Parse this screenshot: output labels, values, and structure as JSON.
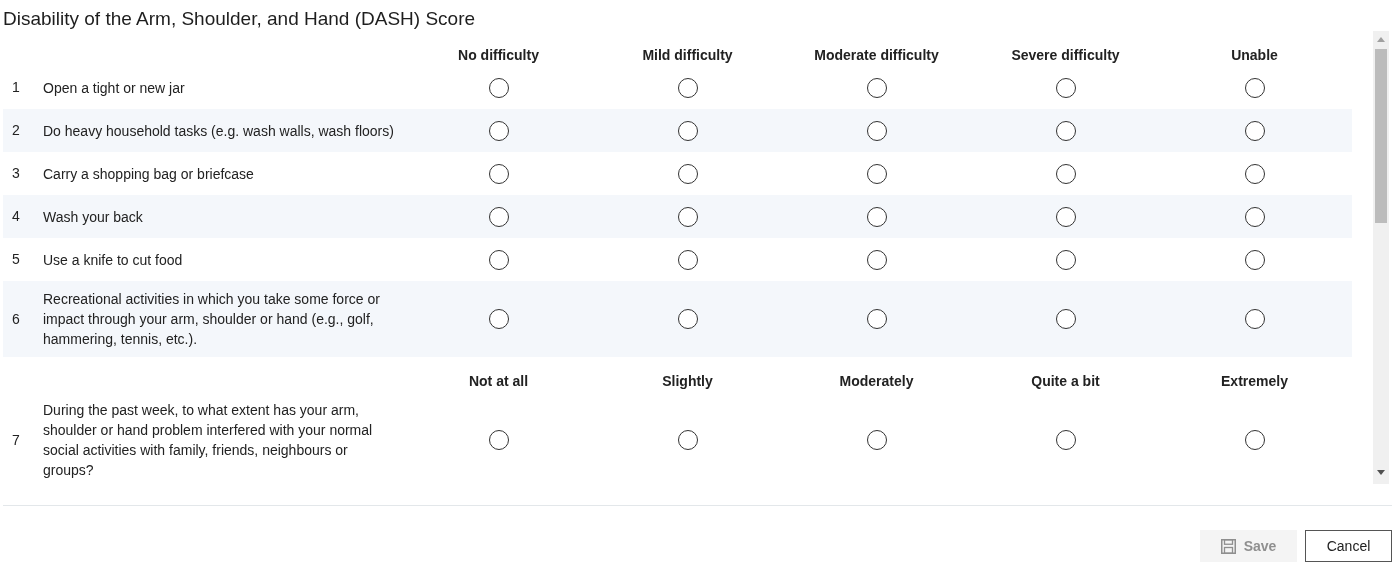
{
  "title": "Disability of the Arm, Shoulder, and Hand (DASH) Score",
  "sections": [
    {
      "options": [
        "No difficulty",
        "Mild difficulty",
        "Moderate difficulty",
        "Severe difficulty",
        "Unable"
      ],
      "questions": [
        {
          "number": "1",
          "text": "Open a tight or new jar",
          "answers": [
            {
              "selected": false
            },
            {
              "selected": false
            },
            {
              "selected": false
            },
            {
              "selected": false
            },
            {
              "selected": false
            }
          ]
        },
        {
          "number": "2",
          "text": "Do heavy household tasks (e.g. wash walls, wash floors)",
          "answers": [
            {
              "selected": false
            },
            {
              "selected": false
            },
            {
              "selected": false
            },
            {
              "selected": false
            },
            {
              "selected": false
            }
          ]
        },
        {
          "number": "3",
          "text": "Carry a shopping bag or briefcase",
          "answers": [
            {
              "selected": false
            },
            {
              "selected": false
            },
            {
              "selected": false
            },
            {
              "selected": false
            },
            {
              "selected": false
            }
          ]
        },
        {
          "number": "4",
          "text": "Wash your back",
          "answers": [
            {
              "selected": false
            },
            {
              "selected": false
            },
            {
              "selected": false
            },
            {
              "selected": false
            },
            {
              "selected": false
            }
          ]
        },
        {
          "number": "5",
          "text": "Use a knife to cut food",
          "answers": [
            {
              "selected": false
            },
            {
              "selected": false
            },
            {
              "selected": false
            },
            {
              "selected": false
            },
            {
              "selected": false
            }
          ]
        },
        {
          "number": "6",
          "text": "Recreational activities in which you take some force or impact through your arm, shoulder or hand (e.g., golf, hammering, tennis, etc.).",
          "answers": [
            {
              "selected": false
            },
            {
              "selected": false
            },
            {
              "selected": false
            },
            {
              "selected": false
            },
            {
              "selected": false
            }
          ]
        }
      ]
    },
    {
      "options": [
        "Not at all",
        "Slightly",
        "Moderately",
        "Quite a bit",
        "Extremely"
      ],
      "questions": [
        {
          "number": "7",
          "text": "During the past week, to what extent has your arm, shoulder or hand problem interfered with your normal social activities with family, friends, neighbours or groups?",
          "answers": [
            {
              "selected": false
            },
            {
              "selected": false
            },
            {
              "selected": false
            },
            {
              "selected": false
            },
            {
              "selected": false
            }
          ]
        }
      ]
    }
  ],
  "buttons": [
    {
      "kind": "save",
      "label": "Save",
      "disabled": true
    },
    {
      "kind": "cancel",
      "label": "Cancel",
      "disabled": false
    }
  ]
}
